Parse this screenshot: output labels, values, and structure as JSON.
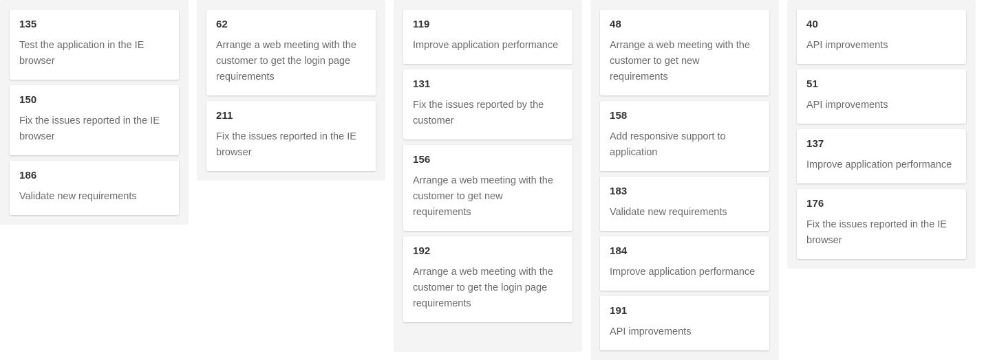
{
  "board": {
    "column_background": "#f4f4f4",
    "card_background": "#ffffff",
    "id_color": "#333333",
    "description_color": "#6b6b6b",
    "columns": [
      {
        "name": "column-1",
        "clipped": false,
        "cards": [
          {
            "id": "135",
            "description": "Test the application in the IE browser"
          },
          {
            "id": "150",
            "description": "Fix the issues reported in the IE browser"
          },
          {
            "id": "186",
            "description": "Validate new requirements"
          }
        ]
      },
      {
        "name": "column-2",
        "clipped": false,
        "cards": [
          {
            "id": "62",
            "description": "Arrange a web meeting with the customer to get the login page requirements"
          },
          {
            "id": "211",
            "description": "Fix the issues reported in the IE browser"
          }
        ]
      },
      {
        "name": "column-3",
        "clipped": true,
        "cards": [
          {
            "id": "119",
            "description": "Improve application performance"
          },
          {
            "id": "131",
            "description": "Fix the issues reported by the customer"
          },
          {
            "id": "156",
            "description": "Arrange a web meeting with the customer to get new requirements"
          },
          {
            "id": "192",
            "description": "Arrange a web meeting with the customer to get the login page requirements"
          }
        ]
      },
      {
        "name": "column-4",
        "clipped": true,
        "cards": [
          {
            "id": "48",
            "description": "Arrange a web meeting with the customer to get new requirements"
          },
          {
            "id": "158",
            "description": "Add responsive support to application"
          },
          {
            "id": "183",
            "description": "Validate new requirements"
          },
          {
            "id": "184",
            "description": "Improve application performance"
          },
          {
            "id": "191",
            "description": "API improvements"
          }
        ]
      },
      {
        "name": "column-5",
        "clipped": false,
        "cards": [
          {
            "id": "40",
            "description": "API improvements"
          },
          {
            "id": "51",
            "description": "API improvements"
          },
          {
            "id": "137",
            "description": "Improve application performance"
          },
          {
            "id": "176",
            "description": "Fix the issues reported in the IE browser"
          }
        ]
      }
    ]
  }
}
